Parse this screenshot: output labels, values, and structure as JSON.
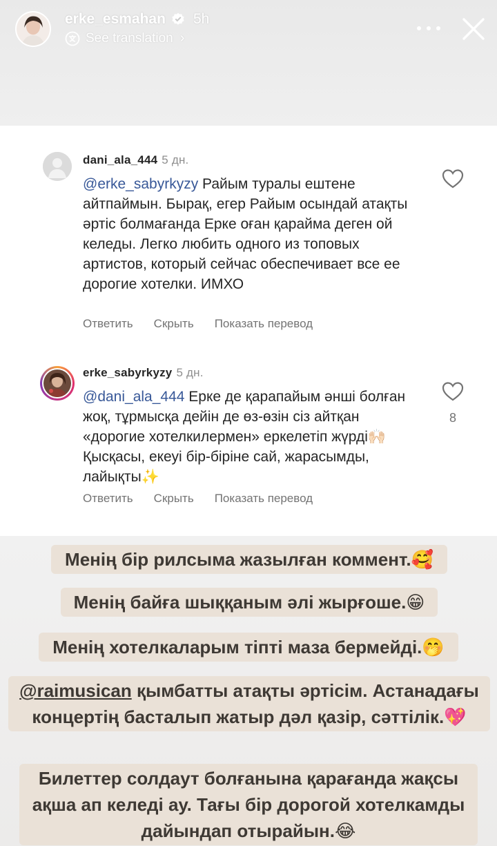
{
  "story": {
    "username": "erke_esmahan",
    "time": "5h",
    "see_translation": "See translation"
  },
  "comments": [
    {
      "username": "dani_ala_444",
      "time": "5 дн.",
      "mention": "@erke_sabyrkyzy",
      "text": " Райым туралы ештене айтпаймын. Бырақ, егер Райым осындай атақты әртіс болмағанда Ерке оған қарайма деген ой келеды. Легко любить одного из топовых артистов, который сейчас обеспечивает все ее дорогие хотелки. ИМХО",
      "actions": {
        "reply": "Ответить",
        "hide": "Скрыть",
        "translate": "Показать перевод"
      },
      "likes": ""
    },
    {
      "username": "erke_sabyrkyzy",
      "time": "5 дн.",
      "mention": "@dani_ala_444",
      "text": " Ерке де қарапайым әнші болған жоқ, тұрмысқа дейін де өз-өзін сіз айтқан «дорогие хотелкилермен» еркелетіп жүрді🙌🏻 Қысқасы, екеуі бір-біріне сай, жарасымды, лайықты✨",
      "actions": {
        "reply": "Ответить",
        "hide": "Скрыть",
        "translate": "Показать перевод"
      },
      "likes": "8"
    }
  ],
  "captions": [
    {
      "text": "Менің бір рилсыма жазылған коммент.🥰"
    },
    {
      "text": "Менің байға шыққаным әлі жырғоше.😁"
    },
    {
      "text": "Менің хотелкаларым тіпті маза бермейді.🤭"
    },
    {
      "tag": "@raimusican",
      "text": " қымбатты атақты әртісім. Астанадағы концертің басталып жатыр дәл қазір, сәттілік.💖"
    },
    {
      "text": "Билеттер солдаут болғанына қарағанда жақсы ақша ап келеді ау. Тағы бір дорогой хотелкамды дайындап отырайын.😂"
    }
  ],
  "icons": {
    "verified": "verified-badge-icon",
    "translate": "translate-icon",
    "more": "more-options-icon",
    "close": "close-icon",
    "heart": "heart-outline-icon"
  },
  "colors": {
    "mention": "#385898",
    "verified": "#3897f0",
    "caption_bg": "#e9dfd5",
    "caption_text": "#3e3934"
  }
}
